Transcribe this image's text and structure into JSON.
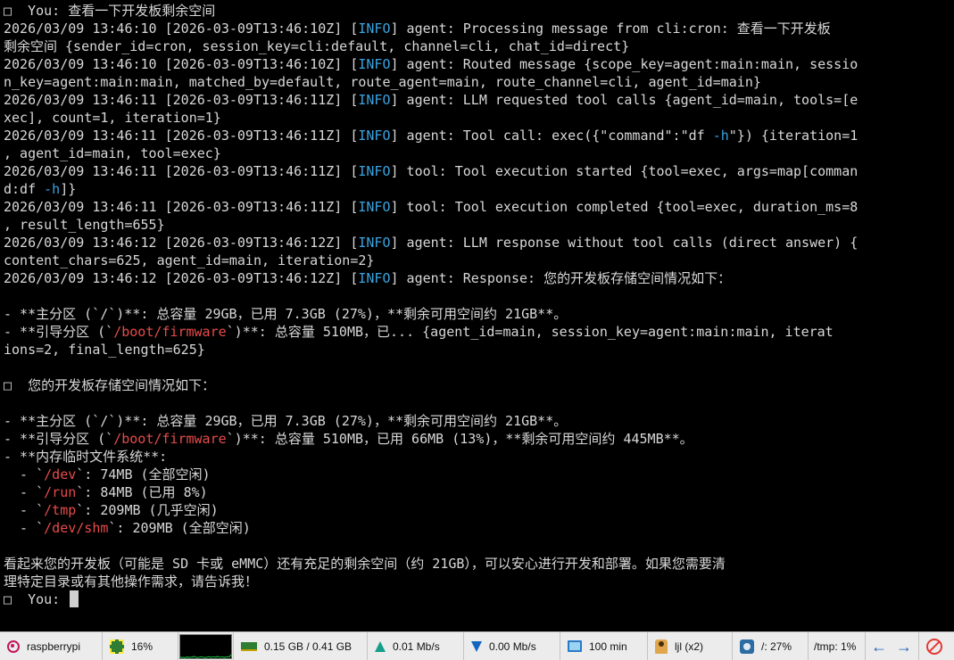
{
  "terminal": {
    "lines": [
      [
        {
          "t": "□  You: 查看一下开发板剩余空间"
        }
      ],
      [
        {
          "t": "2026/03/09 13:46:10 [2026-03-09T13:46:10Z] ["
        },
        {
          "t": "INFO",
          "c": "info"
        },
        {
          "t": "] agent: Processing message from cli:cron: 查看一下开发板"
        }
      ],
      [
        {
          "t": "剩余空间 {sender_id=cron, session_key=cli:default, channel=cli, chat_id=direct}"
        }
      ],
      [
        {
          "t": "2026/03/09 13:46:10 [2026-03-09T13:46:10Z] ["
        },
        {
          "t": "INFO",
          "c": "info"
        },
        {
          "t": "] agent: Routed message {scope_key=agent:main:main, sessio"
        }
      ],
      [
        {
          "t": "n_key=agent:main:main, matched_by=default, route_agent=main, route_channel=cli, agent_id=main}"
        }
      ],
      [
        {
          "t": "2026/03/09 13:46:11 [2026-03-09T13:46:11Z] ["
        },
        {
          "t": "INFO",
          "c": "info"
        },
        {
          "t": "] agent: LLM requested tool calls {agent_id=main, tools=[e"
        }
      ],
      [
        {
          "t": "xec], count=1, iteration=1}"
        }
      ],
      [
        {
          "t": "2026/03/09 13:46:11 [2026-03-09T13:46:11Z] ["
        },
        {
          "t": "INFO",
          "c": "info"
        },
        {
          "t": "] agent: Tool call: exec({\"command\":\"df "
        },
        {
          "t": "-h",
          "c": "info"
        },
        {
          "t": "\"}) {iteration=1"
        }
      ],
      [
        {
          "t": ", agent_id=main, tool=exec}"
        }
      ],
      [
        {
          "t": "2026/03/09 13:46:11 [2026-03-09T13:46:11Z] ["
        },
        {
          "t": "INFO",
          "c": "info"
        },
        {
          "t": "] tool: Tool execution started {tool=exec, args=map[comman"
        }
      ],
      [
        {
          "t": "d:df "
        },
        {
          "t": "-h",
          "c": "info"
        },
        {
          "t": "]}"
        }
      ],
      [
        {
          "t": "2026/03/09 13:46:11 [2026-03-09T13:46:11Z] ["
        },
        {
          "t": "INFO",
          "c": "info"
        },
        {
          "t": "] tool: Tool execution completed {tool=exec, duration_ms=8"
        }
      ],
      [
        {
          "t": ", result_length=655}"
        }
      ],
      [
        {
          "t": "2026/03/09 13:46:12 [2026-03-09T13:46:12Z] ["
        },
        {
          "t": "INFO",
          "c": "info"
        },
        {
          "t": "] agent: LLM response without tool calls (direct answer) {"
        }
      ],
      [
        {
          "t": "content_chars=625, agent_id=main, iteration=2}"
        }
      ],
      [
        {
          "t": "2026/03/09 13:46:12 [2026-03-09T13:46:12Z] ["
        },
        {
          "t": "INFO",
          "c": "info"
        },
        {
          "t": "] agent: Response: 您的开发板存储空间情况如下："
        }
      ],
      [
        {
          "t": ""
        }
      ],
      [
        {
          "t": "- **主分区 (`/`)**: 总容量 29GB，已用 7.3GB (27%)，**剩余可用空间约 21GB**。"
        }
      ],
      [
        {
          "t": "- **引导分区 (`"
        },
        {
          "t": "/boot/firmware",
          "c": "hl"
        },
        {
          "t": "`)**: 总容量 510MB，已... {agent_id=main, session_key=agent:main:main, iterat"
        }
      ],
      [
        {
          "t": "ions=2, final_length=625}"
        }
      ],
      [
        {
          "t": ""
        }
      ],
      [
        {
          "t": "□  您的开发板存储空间情况如下："
        }
      ],
      [
        {
          "t": ""
        }
      ],
      [
        {
          "t": "- **主分区 (`/`)**: 总容量 29GB，已用 7.3GB (27%)，**剩余可用空间约 21GB**。"
        }
      ],
      [
        {
          "t": "- **引导分区 (`"
        },
        {
          "t": "/boot/firmware",
          "c": "hl"
        },
        {
          "t": "`)**: 总容量 510MB，已用 66MB (13%)，**剩余可用空间约 445MB**。"
        }
      ],
      [
        {
          "t": "- **内存临时文件系统**:"
        }
      ],
      [
        {
          "t": "  - `"
        },
        {
          "t": "/dev",
          "c": "hl"
        },
        {
          "t": "`: 74MB (全部空闲)"
        }
      ],
      [
        {
          "t": "  - `"
        },
        {
          "t": "/run",
          "c": "hl"
        },
        {
          "t": "`: 84MB (已用 8%)"
        }
      ],
      [
        {
          "t": "  - `"
        },
        {
          "t": "/tmp",
          "c": "hl"
        },
        {
          "t": "`: 209MB (几乎空闲)"
        }
      ],
      [
        {
          "t": "  - `"
        },
        {
          "t": "/dev/shm",
          "c": "hl"
        },
        {
          "t": "`: 209MB (全部空闲)"
        }
      ],
      [
        {
          "t": ""
        }
      ],
      [
        {
          "t": "看起来您的开发板（可能是 SD 卡或 eMMC）还有充足的剩余空间（约 21GB），可以安心进行开发和部署。如果您需要清"
        }
      ],
      [
        {
          "t": "理特定目录或有其他操作需求，请告诉我！"
        }
      ],
      [
        {
          "t": ""
        }
      ]
    ],
    "prompt": "□  You: "
  },
  "statusbar": {
    "hostname": "raspberrypi",
    "cpu_percent": "16%",
    "cpu_history": [
      0.05,
      0.03,
      0.04,
      0.02,
      0.06,
      0.03,
      0.05,
      0.04,
      0.08,
      0.05,
      0.03,
      0.04,
      0.06,
      0.05,
      0.04,
      0.03,
      0.05,
      0.07,
      0.04,
      0.05,
      0.06,
      0.04,
      0.08,
      0.05,
      0.04,
      0.06,
      0.03,
      0.05,
      0.07,
      0.06,
      0.16
    ],
    "memory": "0.15 GB / 0.41 GB",
    "upload": "0.01 Mb/s",
    "download": "0.00 Mb/s",
    "uptime": "100 min",
    "users": "ljl (x2)",
    "disk_root": "/: 27%",
    "disk_tmp": "/tmp: 1%"
  },
  "colors": {
    "background": "#000000",
    "text": "#d8d8d8",
    "info": "#3aa3e0",
    "path_highlight": "#e64b4b",
    "statusbar_bg": "#ececec",
    "cpu_graph_line": "#1bd14a"
  }
}
